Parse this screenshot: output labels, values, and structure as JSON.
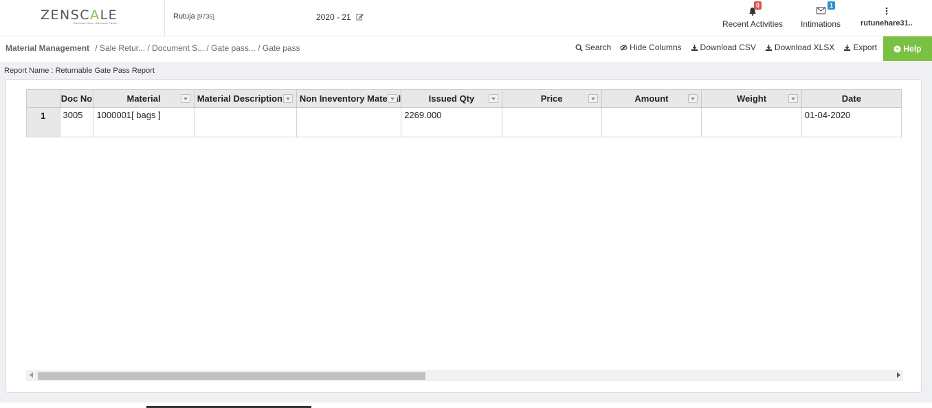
{
  "header": {
    "logo_main": "ZENSC",
    "logo_accent": "A",
    "logo_end": "LE",
    "logo_tagline": "Business Goes. Business Faster.",
    "user_name": "Rutuja",
    "user_code": "[9736]",
    "fiscal_year": "2020 - 21",
    "recent_activities_label": "Recent Activities",
    "recent_activities_count": "0",
    "intimations_label": "Intimations",
    "intimations_count": "1",
    "user_menu_label": "rutunehare31.."
  },
  "breadcrumb": {
    "root": "Material Management",
    "items": [
      "/ Sale Retur...",
      "/ Document S...",
      "/ Gate pass...",
      "/ Gate pass"
    ]
  },
  "toolbar": {
    "search": "Search",
    "hide_columns": "Hide Columns",
    "download_csv": "Download CSV",
    "download_xlsx": "Download XLSX",
    "export": "Export",
    "help": "Help"
  },
  "report": {
    "name": "Report Name : Returnable Gate Pass Report"
  },
  "table": {
    "columns": [
      "Doc No",
      "Material",
      "Material Description",
      "Non Ineventory Material",
      "Issued Qty",
      "Price",
      "Amount",
      "Weight",
      "Date"
    ],
    "rows": [
      {
        "index": "1",
        "cells": [
          "3005",
          "1000001[ bags ]",
          "",
          "",
          "2269.000",
          "",
          "",
          "",
          "01-04-2020"
        ]
      }
    ]
  },
  "colors": {
    "accent_green": "#7ac143",
    "badge_red": "#d9534f",
    "badge_blue": "#2f8fc9"
  }
}
